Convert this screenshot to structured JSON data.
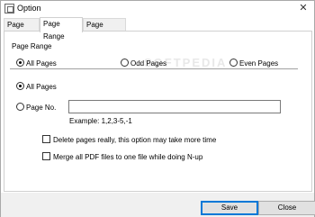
{
  "window": {
    "title": "Option"
  },
  "tabs": [
    {
      "label": "Page Size"
    },
    {
      "label": "Page Range"
    },
    {
      "label": "Page Rotate"
    }
  ],
  "active_tab": "Page Range",
  "page_range": {
    "group_label": "Page Range",
    "top_options": [
      "All Pages",
      "Odd Pages",
      "Even Pages"
    ],
    "selected_top_option": "All Pages",
    "mode_options": [
      "All Pages",
      "Page No."
    ],
    "selected_mode_option": "All Pages",
    "page_no_value": "",
    "example": "Example: 1,2,3-5,-1"
  },
  "options": {
    "delete_pages": "Delete pages really, this option may take more time",
    "merge_pdfs": "Merge all PDF files to one file while doing N-up",
    "delete_pages_checked": false,
    "merge_pdfs_checked": false
  },
  "watermark": "SOFTPEDIA",
  "buttons": {
    "save": "Save",
    "close": "Close"
  }
}
